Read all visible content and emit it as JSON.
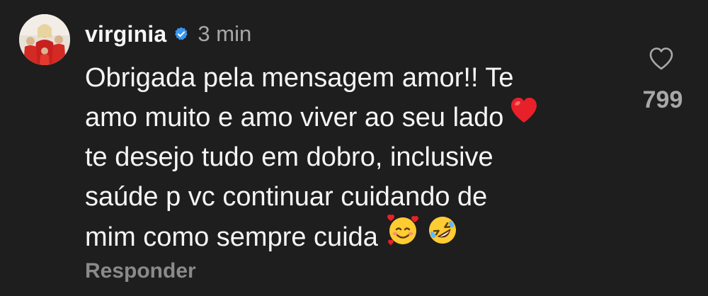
{
  "comment": {
    "author": {
      "username": "virginia",
      "verified": true,
      "avatar_icon": "profile-photo"
    },
    "timestamp": "3 min",
    "lines": [
      "Obrigada pela mensagem amor!! Te",
      "amo muito e amo viver ao seu lado",
      "te desejo tudo em dobro, inclusive",
      "saúde p vc continuar cuidando de",
      "mim como sempre cuida"
    ],
    "emojis": {
      "line2": "red-heart",
      "line5": [
        "smiling-face-with-hearts",
        "rolling-on-the-floor-laughing"
      ]
    },
    "reply_label": "Responder",
    "likes": {
      "count": "799",
      "icon": "heart-outline-icon"
    }
  },
  "colors": {
    "background": "#1e1e1e",
    "text": "#f5f5f5",
    "secondary": "#a8a8a8",
    "verified_badge": "#3797f0"
  }
}
